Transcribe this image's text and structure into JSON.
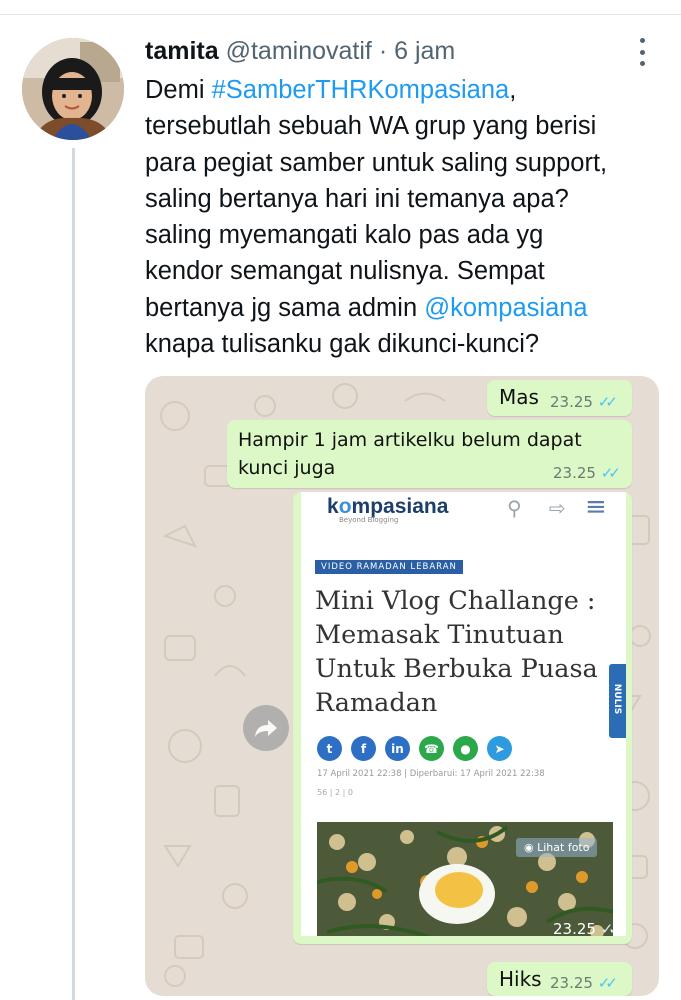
{
  "tweet": {
    "name": "tamita",
    "handle": "@taminovatif",
    "separator": "·",
    "time": "6 jam",
    "lines": [
      {
        "before": "Demi ",
        "link": "#SamberTHRKompasiana",
        "after": ","
      },
      {
        "text": "tersebutlah sebuah WA grup yang berisi"
      },
      {
        "text": "para pegiat samber untuk saling support,"
      },
      {
        "text": "saling bertanya hari ini temanya apa?"
      },
      {
        "text": "saling myemangati kalo pas ada yg"
      },
      {
        "text": "kendor semangat nulisnya. Sempat"
      },
      {
        "before": "bertanya jg sama admin ",
        "link": "@kompasiana",
        "after": ""
      },
      {
        "text": "knapa tulisanku gak dikunci-kunci?"
      }
    ]
  },
  "chat": {
    "messages": [
      {
        "text": "Mas",
        "time": "23.25"
      },
      {
        "text": "Hampir 1 jam artikelku belum dapat kunci juga",
        "time": "23.25"
      },
      {
        "text": "Hiks",
        "time": "23.25"
      }
    ],
    "tick": "✓✓",
    "image_time": "23.25"
  },
  "kompasiana": {
    "logo_left": "k",
    "logo_o": "o",
    "logo_right": "mpasiana",
    "tagline": "Beyond Blogging",
    "category": "VIDEO RAMADAN LEBARAN",
    "title_lines": [
      "Mini Vlog Challange :",
      "Memasak Tinutuan",
      "Untuk Berbuka Puasa",
      "Ramadan"
    ],
    "side_tab": "NULIS",
    "date": "17 April 2021   22:38  |  Diperbarui: 17 April 2021   22:38",
    "stats": "56  |  2  |  0",
    "photo_button": "Lihat foto",
    "share_icons": [
      "twitter-icon",
      "facebook-icon",
      "linkedin-icon",
      "whatsapp-icon",
      "line-icon",
      "telegram-icon"
    ]
  },
  "colors": {
    "link": "#1d9bf0",
    "bubble": "#dcf8c6",
    "read_tick": "#4fc3f7",
    "chat_bg": "#e5ddd4",
    "brand_blue": "#1e3e6a"
  }
}
